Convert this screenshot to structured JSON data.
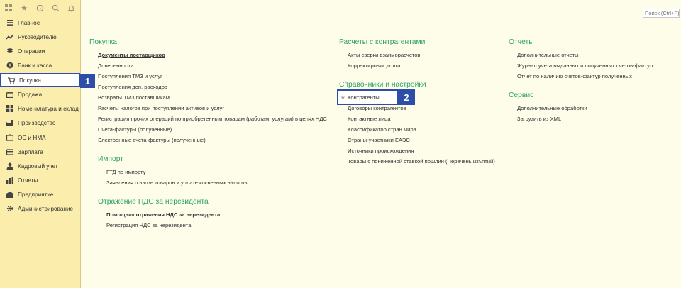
{
  "search": {
    "placeholder": "Поиск (Ctrl+F)"
  },
  "nav": [
    {
      "label": "Главное",
      "icon": "menu-icon"
    },
    {
      "label": "Руководителю",
      "icon": "trend-icon"
    },
    {
      "label": "Операции",
      "icon": "coins-icon"
    },
    {
      "label": "Банк и касса",
      "icon": "bank-icon"
    },
    {
      "label": "Покупка",
      "icon": "cart-icon"
    },
    {
      "label": "Продажа",
      "icon": "sale-icon"
    },
    {
      "label": "Номенклатура и склад",
      "icon": "warehouse-icon"
    },
    {
      "label": "Производство",
      "icon": "factory-icon"
    },
    {
      "label": "ОС и НМА",
      "icon": "assets-icon"
    },
    {
      "label": "Зарплата",
      "icon": "salary-icon"
    },
    {
      "label": "Кадровый учет",
      "icon": "person-icon"
    },
    {
      "label": "Отчеты",
      "icon": "chart-icon"
    },
    {
      "label": "Предприятие",
      "icon": "enterprise-icon"
    },
    {
      "label": "Администрирование",
      "icon": "gear-icon"
    }
  ],
  "badges": {
    "one": "1",
    "two": "2"
  },
  "sections": {
    "pokupka": {
      "title": "Покупка",
      "links": [
        "Документы поставщиков",
        "Доверенности",
        "Поступления ТМЗ и услуг",
        "Поступления доп. расходов",
        "Возвраты ТМЗ поставщикам",
        "Расчеты налогов при поступлении активов и услуг",
        "Регистрация прочих операций по приобретенным товарам (работам, услугам) в целях НДС",
        "Счета-фактуры (полученные)",
        "Электронные счета-фактуры (полученные)"
      ]
    },
    "import": {
      "title": "Импорт",
      "links": [
        "ГТД по импорту",
        "Заявления о ввозе товаров и уплате косвенных налогов"
      ]
    },
    "nds": {
      "title": "Отражение НДС за нерезидента",
      "links": [
        "Помощник отражения НДС за нерезидента",
        "Регистрация НДС за нерезидента"
      ]
    },
    "raschety": {
      "title": "Расчеты с контрагентами",
      "links": [
        "Акты сверки взаиморасчетов",
        "Корректировки долга"
      ]
    },
    "spravochniki": {
      "title": "Справочники и настройки",
      "links": [
        "Контрагенты",
        "Договоры контрагентов",
        "Контактные лица",
        "Классификатор стран мира",
        "Страны-участники ЕАЭС",
        "Источники происхождения",
        "Товары с пониженной ставкой пошлин (Перечень изъятий)"
      ]
    },
    "otchety": {
      "title": "Отчеты",
      "links": [
        "Дополнительные отчеты",
        "Журнал учета выданных и полученных счетов-фактур",
        "Отчет по наличию счетов-фактур полученных"
      ]
    },
    "servis": {
      "title": "Сервис",
      "links": [
        "Дополнительные обработки",
        "Загрузить из XML"
      ]
    }
  }
}
